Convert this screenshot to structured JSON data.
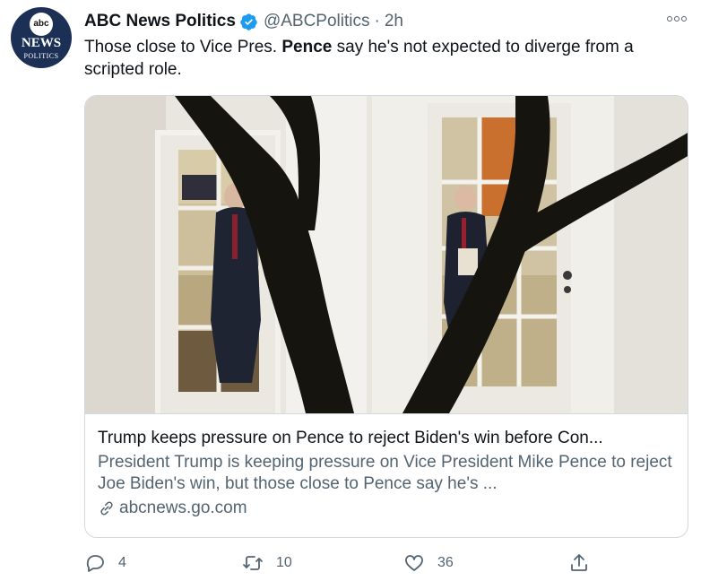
{
  "account": {
    "avatar_abc": "abc",
    "avatar_news": "NEWS",
    "avatar_politics": "POLITICS",
    "display_name": "ABC News Politics",
    "handle": "@ABCPolitics",
    "separator": "·",
    "time": "2h"
  },
  "tweet": {
    "text_before": "Those close to Vice Pres. ",
    "text_bold": "Pence",
    "text_after": " say he's not expected to diverge from a scripted role."
  },
  "card": {
    "title": "Trump keeps pressure on Pence to reject Biden's win before Con...",
    "description": "President Trump is keeping pressure on Vice President Mike Pence to reject Joe Biden's win, but those close to Pence say he's ...",
    "domain": "abcnews.go.com"
  },
  "actions": {
    "replies": "4",
    "retweets": "10",
    "likes": "36"
  },
  "colors": {
    "verified": "#1d9bf0",
    "secondary_text": "#536471",
    "avatar_bg": "#1c2f55"
  },
  "icons": [
    "verified-badge-icon",
    "more-icon",
    "link-icon",
    "reply-icon",
    "retweet-icon",
    "like-icon",
    "share-icon"
  ]
}
